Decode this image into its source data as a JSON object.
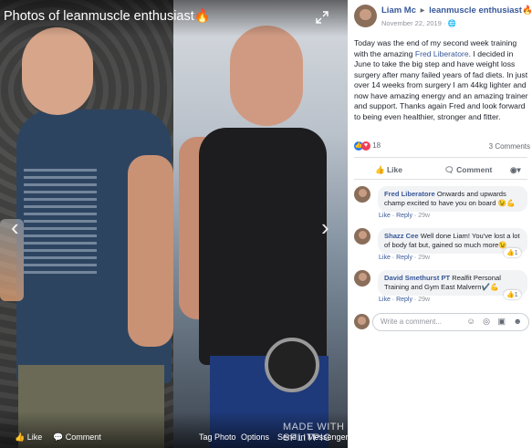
{
  "viewer": {
    "album_title": "Photos of leanmuscle enthusiast🔥",
    "bottom_bar": {
      "like": "Like",
      "comment": "Comment",
      "tag_photo": "Tag Photo",
      "options": "Options",
      "send": "Send in Messenger"
    },
    "watermark": "MADE WITH",
    "watermark2": "SPLITPIC"
  },
  "post": {
    "author": "Liam Mc",
    "arrow": "▸",
    "target": "leanmuscle enthusiast🔥",
    "date": "November 22, 2019 · 🌐",
    "text_before": "Today was the end of my second week training with the amazing ",
    "text_link": "Fred Liberatore",
    "text_after": ". I decided in June to take the big step and have weight loss surgery after many failed years of fad diets. In just over 14 weeks from surgery I am 44kg lighter and now have amazing energy and an amazing trainer and support. Thanks again Fred and look forward to being even healthier, stronger and fitter.",
    "reaction_count": "18",
    "comments_count": "3 Comments",
    "actions": {
      "like": "Like",
      "comment": "Comment"
    }
  },
  "comments": [
    {
      "name": "Fred Liberatore",
      "text": "Onwards and upwards champ excited to have you on board 😉💪",
      "like": "Like",
      "reply": "Reply",
      "time": "29w",
      "likes": ""
    },
    {
      "name": "Shazz Cee",
      "text": "Well done Liam! You've lost a lot of body fat but, gained so much more😉",
      "like": "Like",
      "reply": "Reply",
      "time": "29w",
      "likes": "1"
    },
    {
      "name": "David Smethurst PT",
      "text": "Realfit Personal Training and Gym East Malvern✔️💪",
      "like": "Like",
      "reply": "Reply",
      "time": "29w",
      "likes": "1"
    }
  ],
  "composer": {
    "placeholder": "Write a comment...",
    "tools": "☺ ◎ ▣ ☻"
  },
  "colors": {
    "link": "#385898",
    "muted": "#90949c",
    "like_blue": "#2078f4",
    "love_red": "#f33e58"
  }
}
